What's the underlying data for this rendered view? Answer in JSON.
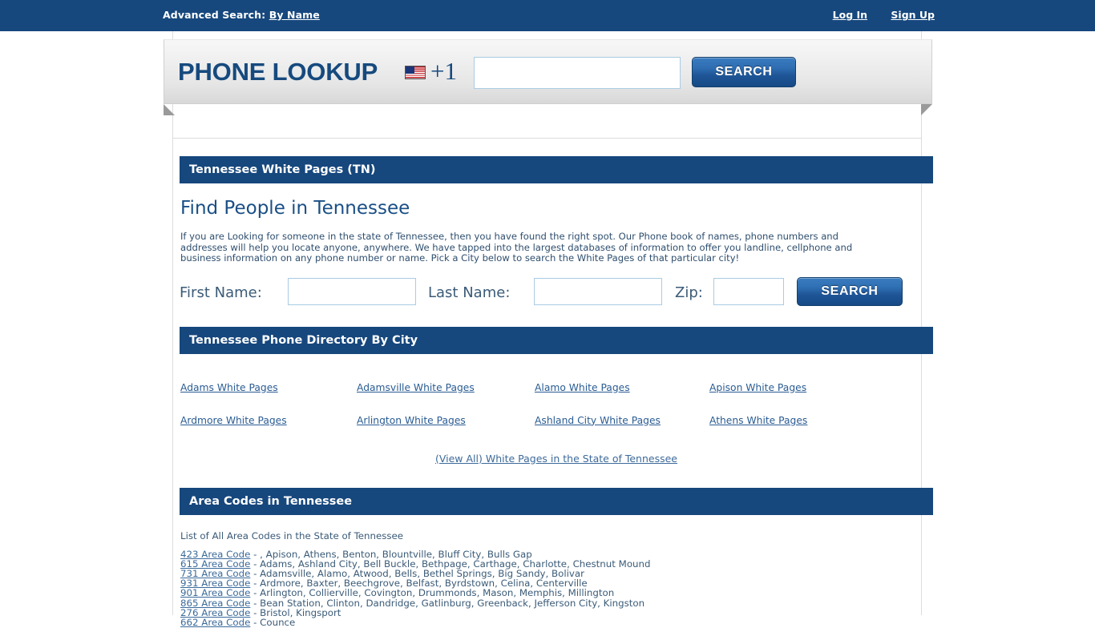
{
  "topbar": {
    "advanced_search_label": "Advanced Search:",
    "advanced_search_link": "By Name",
    "login": "Log In",
    "signup": "Sign Up"
  },
  "hero": {
    "brand": "PHONE LOOKUP",
    "flag_icon": "us-flag-icon",
    "country_code": "+1",
    "phone_value": "",
    "phone_placeholder": "",
    "search_button": "SEARCH"
  },
  "main": {
    "section_title": "Tennessee White Pages (TN)",
    "heading": "Find People in Tennessee",
    "intro": "If you are Looking for someone in the state of Tennessee, then you have found the right spot. Our Phone book of names, phone numbers and addresses will help you locate anyone, anywhere. We have tapped into the largest databases of information to offer you landline, cellphone and business information on any phone number or name. Pick a City below to search the White Pages of that particular city!",
    "name_search": {
      "first_label": "First Name:",
      "first_value": "",
      "last_label": "Last Name:",
      "last_value": "",
      "zip_label": "Zip:",
      "zip_value": "",
      "search_button": "SEARCH"
    },
    "city_section_title": "Tennessee Phone Directory By City",
    "cities": [
      "Adams White Pages",
      "Adamsville White Pages",
      "Alamo White Pages",
      "Apison White Pages",
      "Ardmore White Pages",
      "Arlington White Pages",
      "Ashland City White Pages",
      "Athens White Pages"
    ],
    "view_all": "(View All) White Pages in the State of Tennessee",
    "area_section_title": "Area Codes in Tennessee",
    "area_intro": "List of All Area Codes in the State of Tennessee",
    "area_codes": [
      {
        "code": "423 Area Code",
        "sep": " - ",
        "cities": ", Apison, Athens, Benton, Blountville, Bluff City, Bulls Gap"
      },
      {
        "code": "615 Area Code",
        "sep": " - ",
        "cities": "Adams, Ashland City, Bell Buckle, Bethpage, Carthage, Charlotte, Chestnut Mound"
      },
      {
        "code": "731 Area Code",
        "sep": " - ",
        "cities": "Adamsville, Alamo, Atwood, Bells, Bethel Springs, Big Sandy, Bolivar"
      },
      {
        "code": "931 Area Code",
        "sep": " - ",
        "cities": "Ardmore, Baxter, Beechgrove, Belfast, Byrdstown, Celina, Centerville"
      },
      {
        "code": "901 Area Code",
        "sep": " - ",
        "cities": "Arlington, Collierville, Covington, Drummonds, Mason, Memphis, Millington"
      },
      {
        "code": "865 Area Code",
        "sep": " - ",
        "cities": "Bean Station, Clinton, Dandridge, Gatlinburg, Greenback, Jefferson City, Kingston"
      },
      {
        "code": "276 Area Code",
        "sep": " - ",
        "cities": "Bristol, Kingsport"
      },
      {
        "code": "662 Area Code",
        "sep": " - ",
        "cities": "Counce"
      }
    ]
  },
  "colors": {
    "header_blue": "#16477d",
    "link_blue": "#2a5c93",
    "heading_blue": "#1a4f86",
    "button_blue": "#2f6eb3"
  }
}
